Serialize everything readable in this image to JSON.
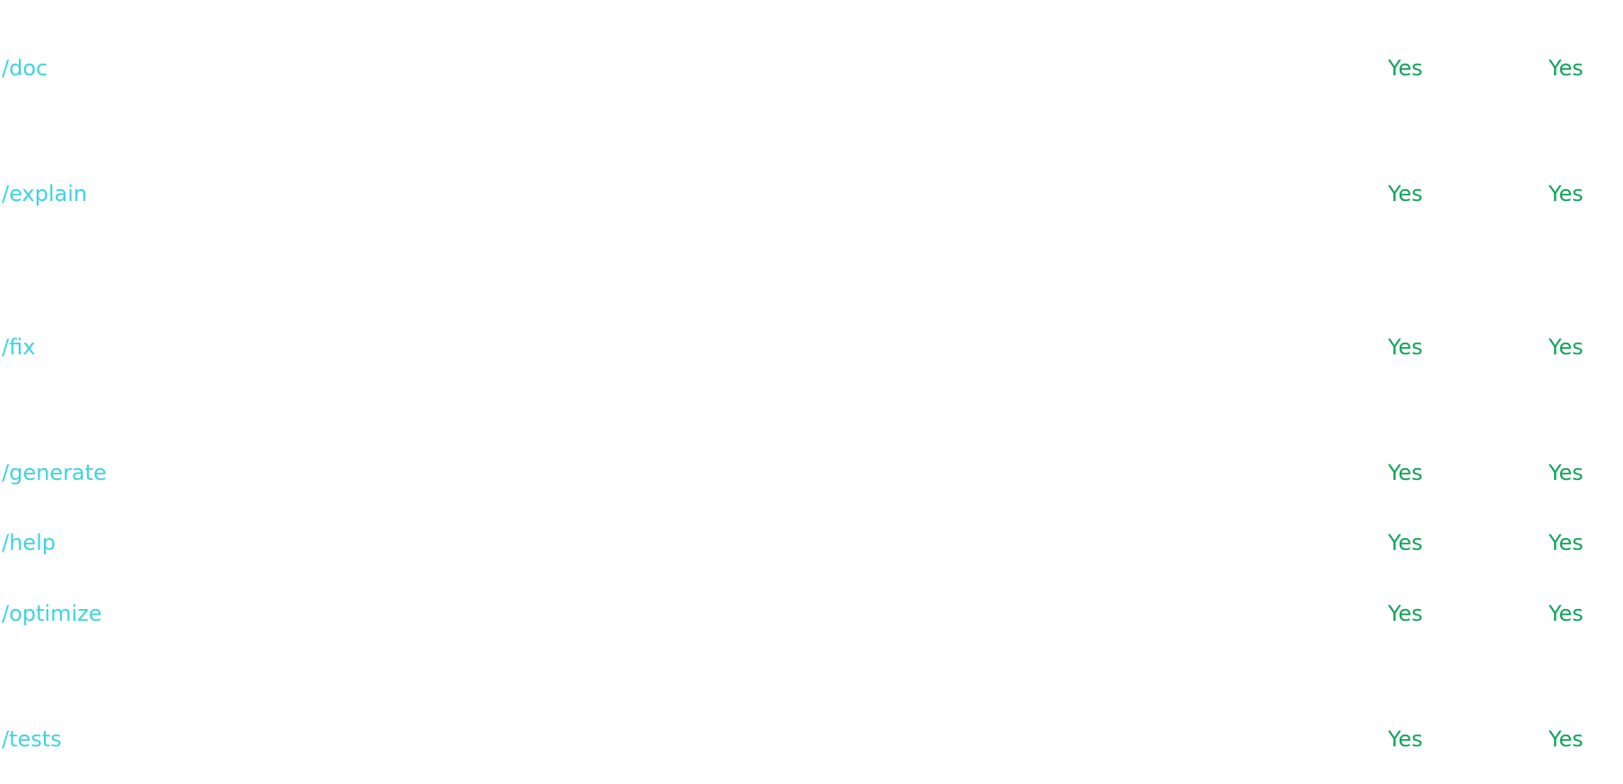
{
  "rows": [
    {
      "command": "/doc",
      "col_a": "Yes",
      "col_b": "Yes"
    },
    {
      "command": "/explain",
      "col_a": "Yes",
      "col_b": "Yes"
    },
    {
      "command": "/fix",
      "col_a": "Yes",
      "col_b": "Yes"
    },
    {
      "command": "/generate",
      "col_a": "Yes",
      "col_b": "Yes"
    },
    {
      "command": "/help",
      "col_a": "Yes",
      "col_b": "Yes"
    },
    {
      "command": "/optimize",
      "col_a": "Yes",
      "col_b": "Yes"
    },
    {
      "command": "/tests",
      "col_a": "Yes",
      "col_b": "Yes"
    }
  ],
  "colors": {
    "command_link": "#3fd3e0",
    "yes_text": "#12a35a",
    "background": "#ffffff"
  }
}
